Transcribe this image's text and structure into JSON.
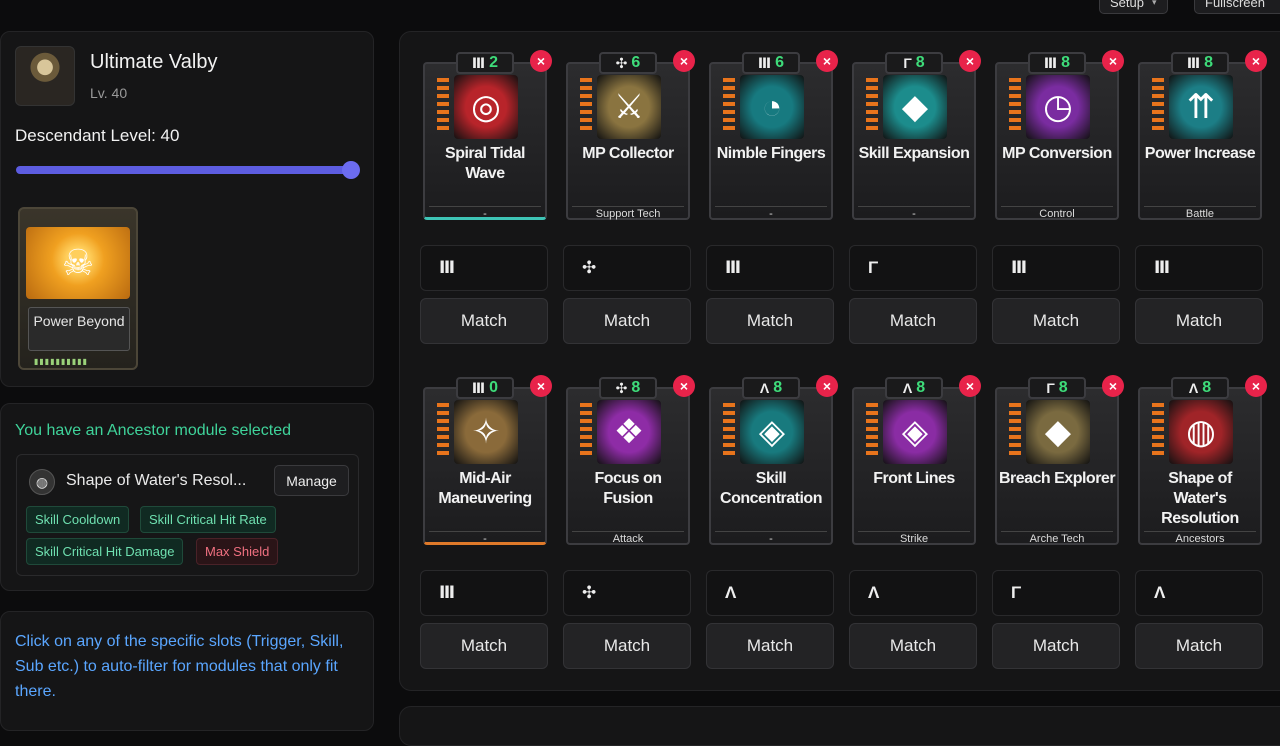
{
  "topbar": {
    "setup_label": "Setup",
    "fullscreen_label": "Fullscreen"
  },
  "character": {
    "name": "Ultimate Valby",
    "level": "Lv. 40",
    "descendant_level_label": "Descendant Level: 40",
    "descendant_level_fraction": 1.0
  },
  "ancestor_card": {
    "label": "Power Beyond"
  },
  "ancestor": {
    "title": "You have an Ancestor module selected",
    "module_name": "Shape of Water's Resol...",
    "manage_label": "Manage",
    "tags": [
      {
        "text": "Skill Cooldown",
        "color": "green"
      },
      {
        "text": "Skill Critical Hit Rate",
        "color": "green"
      },
      {
        "text": "Skill Critical Hit Damage",
        "color": "green"
      },
      {
        "text": "Max Shield",
        "color": "red"
      }
    ]
  },
  "hint": "Click on any of the specific slots (Trigger, Skill, Sub etc.) to auto-filter for modules that only fit there.",
  "match_label": "Match",
  "modules": [
    {
      "name": "Spiral Tidal Wave",
      "socket": "W",
      "cost": "2",
      "type": "-",
      "icon": "spiral-wave-icon",
      "glyph": "◎",
      "bg": "#b8242a",
      "accent": "teal"
    },
    {
      "name": "MP Collector",
      "socket": "X",
      "cost": "6",
      "type": "Support Tech",
      "icon": "claw-icon",
      "glyph": "⚔",
      "bg": "#8a7440",
      "accent": ""
    },
    {
      "name": "Nimble Fingers",
      "socket": "W",
      "cost": "6",
      "type": "-",
      "icon": "clock-down-icon",
      "glyph": "◔",
      "bg": "#177a80",
      "accent": ""
    },
    {
      "name": "Skill Expansion",
      "socket": "P",
      "cost": "8",
      "type": "-",
      "icon": "diamond-burst-icon",
      "glyph": "◆",
      "bg": "#1c8c8c",
      "accent": ""
    },
    {
      "name": "MP Conversion",
      "socket": "W",
      "cost": "8",
      "type": "Control",
      "icon": "gauge-arrow-icon",
      "glyph": "◷",
      "bg": "#7a2ca0",
      "accent": ""
    },
    {
      "name": "Power Increase",
      "socket": "W",
      "cost": "8",
      "type": "Battle",
      "icon": "arrows-up-icon",
      "glyph": "⇈",
      "bg": "#1c7e86",
      "accent": ""
    },
    {
      "name": "Mid-Air Maneuvering",
      "socket": "W",
      "cost": "0",
      "type": "-",
      "icon": "grapple-icon",
      "glyph": "✧",
      "bg": "#8a6a3a",
      "accent": "orange"
    },
    {
      "name": "Focus on Fusion",
      "socket": "X",
      "cost": "8",
      "type": "Attack",
      "icon": "fusion-icon",
      "glyph": "❖",
      "bg": "#8e2ca6",
      "accent": ""
    },
    {
      "name": "Skill Concentration",
      "socket": "A",
      "cost": "8",
      "type": "-",
      "icon": "diamond-grid-icon",
      "glyph": "◈",
      "bg": "#187a7e",
      "accent": ""
    },
    {
      "name": "Front Lines",
      "socket": "A",
      "cost": "8",
      "type": "Strike",
      "icon": "diamond-grid-icon",
      "glyph": "◈",
      "bg": "#8a2ca4",
      "accent": ""
    },
    {
      "name": "Breach Explorer",
      "socket": "P",
      "cost": "8",
      "type": "Arche Tech",
      "icon": "ring-diamond-icon",
      "glyph": "◆",
      "bg": "#7a6a40",
      "accent": ""
    },
    {
      "name": "Shape of Water's Resolution",
      "socket": "A",
      "cost": "8",
      "type": "Ancestors",
      "icon": "water-shell-icon",
      "glyph": "◍",
      "bg": "#a02428",
      "accent": ""
    }
  ]
}
